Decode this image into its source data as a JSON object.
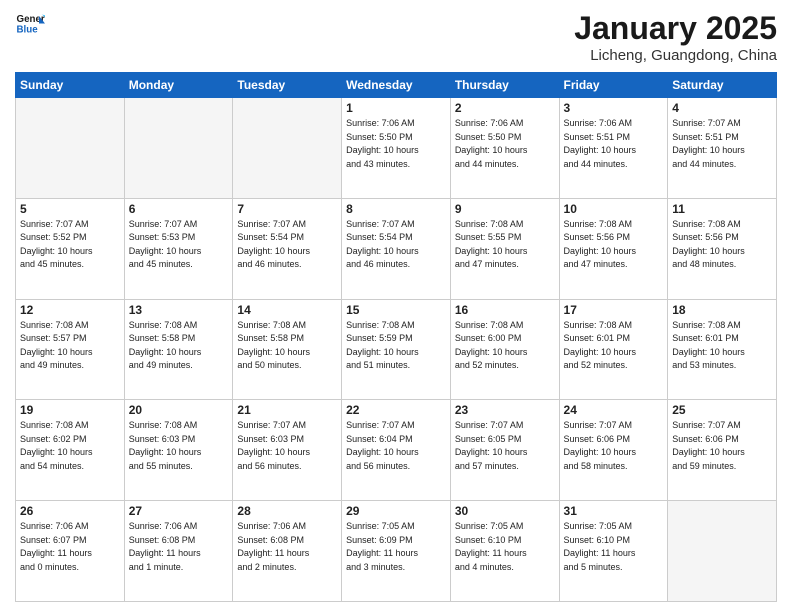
{
  "logo": {
    "line1": "General",
    "line2": "Blue"
  },
  "title": "January 2025",
  "location": "Licheng, Guangdong, China",
  "weekdays": [
    "Sunday",
    "Monday",
    "Tuesday",
    "Wednesday",
    "Thursday",
    "Friday",
    "Saturday"
  ],
  "weeks": [
    [
      {
        "day": "",
        "info": ""
      },
      {
        "day": "",
        "info": ""
      },
      {
        "day": "",
        "info": ""
      },
      {
        "day": "1",
        "info": "Sunrise: 7:06 AM\nSunset: 5:50 PM\nDaylight: 10 hours\nand 43 minutes."
      },
      {
        "day": "2",
        "info": "Sunrise: 7:06 AM\nSunset: 5:50 PM\nDaylight: 10 hours\nand 44 minutes."
      },
      {
        "day": "3",
        "info": "Sunrise: 7:06 AM\nSunset: 5:51 PM\nDaylight: 10 hours\nand 44 minutes."
      },
      {
        "day": "4",
        "info": "Sunrise: 7:07 AM\nSunset: 5:51 PM\nDaylight: 10 hours\nand 44 minutes."
      }
    ],
    [
      {
        "day": "5",
        "info": "Sunrise: 7:07 AM\nSunset: 5:52 PM\nDaylight: 10 hours\nand 45 minutes."
      },
      {
        "day": "6",
        "info": "Sunrise: 7:07 AM\nSunset: 5:53 PM\nDaylight: 10 hours\nand 45 minutes."
      },
      {
        "day": "7",
        "info": "Sunrise: 7:07 AM\nSunset: 5:54 PM\nDaylight: 10 hours\nand 46 minutes."
      },
      {
        "day": "8",
        "info": "Sunrise: 7:07 AM\nSunset: 5:54 PM\nDaylight: 10 hours\nand 46 minutes."
      },
      {
        "day": "9",
        "info": "Sunrise: 7:08 AM\nSunset: 5:55 PM\nDaylight: 10 hours\nand 47 minutes."
      },
      {
        "day": "10",
        "info": "Sunrise: 7:08 AM\nSunset: 5:56 PM\nDaylight: 10 hours\nand 47 minutes."
      },
      {
        "day": "11",
        "info": "Sunrise: 7:08 AM\nSunset: 5:56 PM\nDaylight: 10 hours\nand 48 minutes."
      }
    ],
    [
      {
        "day": "12",
        "info": "Sunrise: 7:08 AM\nSunset: 5:57 PM\nDaylight: 10 hours\nand 49 minutes."
      },
      {
        "day": "13",
        "info": "Sunrise: 7:08 AM\nSunset: 5:58 PM\nDaylight: 10 hours\nand 49 minutes."
      },
      {
        "day": "14",
        "info": "Sunrise: 7:08 AM\nSunset: 5:58 PM\nDaylight: 10 hours\nand 50 minutes."
      },
      {
        "day": "15",
        "info": "Sunrise: 7:08 AM\nSunset: 5:59 PM\nDaylight: 10 hours\nand 51 minutes."
      },
      {
        "day": "16",
        "info": "Sunrise: 7:08 AM\nSunset: 6:00 PM\nDaylight: 10 hours\nand 52 minutes."
      },
      {
        "day": "17",
        "info": "Sunrise: 7:08 AM\nSunset: 6:01 PM\nDaylight: 10 hours\nand 52 minutes."
      },
      {
        "day": "18",
        "info": "Sunrise: 7:08 AM\nSunset: 6:01 PM\nDaylight: 10 hours\nand 53 minutes."
      }
    ],
    [
      {
        "day": "19",
        "info": "Sunrise: 7:08 AM\nSunset: 6:02 PM\nDaylight: 10 hours\nand 54 minutes."
      },
      {
        "day": "20",
        "info": "Sunrise: 7:08 AM\nSunset: 6:03 PM\nDaylight: 10 hours\nand 55 minutes."
      },
      {
        "day": "21",
        "info": "Sunrise: 7:07 AM\nSunset: 6:03 PM\nDaylight: 10 hours\nand 56 minutes."
      },
      {
        "day": "22",
        "info": "Sunrise: 7:07 AM\nSunset: 6:04 PM\nDaylight: 10 hours\nand 56 minutes."
      },
      {
        "day": "23",
        "info": "Sunrise: 7:07 AM\nSunset: 6:05 PM\nDaylight: 10 hours\nand 57 minutes."
      },
      {
        "day": "24",
        "info": "Sunrise: 7:07 AM\nSunset: 6:06 PM\nDaylight: 10 hours\nand 58 minutes."
      },
      {
        "day": "25",
        "info": "Sunrise: 7:07 AM\nSunset: 6:06 PM\nDaylight: 10 hours\nand 59 minutes."
      }
    ],
    [
      {
        "day": "26",
        "info": "Sunrise: 7:06 AM\nSunset: 6:07 PM\nDaylight: 11 hours\nand 0 minutes."
      },
      {
        "day": "27",
        "info": "Sunrise: 7:06 AM\nSunset: 6:08 PM\nDaylight: 11 hours\nand 1 minute."
      },
      {
        "day": "28",
        "info": "Sunrise: 7:06 AM\nSunset: 6:08 PM\nDaylight: 11 hours\nand 2 minutes."
      },
      {
        "day": "29",
        "info": "Sunrise: 7:05 AM\nSunset: 6:09 PM\nDaylight: 11 hours\nand 3 minutes."
      },
      {
        "day": "30",
        "info": "Sunrise: 7:05 AM\nSunset: 6:10 PM\nDaylight: 11 hours\nand 4 minutes."
      },
      {
        "day": "31",
        "info": "Sunrise: 7:05 AM\nSunset: 6:10 PM\nDaylight: 11 hours\nand 5 minutes."
      },
      {
        "day": "",
        "info": ""
      }
    ]
  ]
}
